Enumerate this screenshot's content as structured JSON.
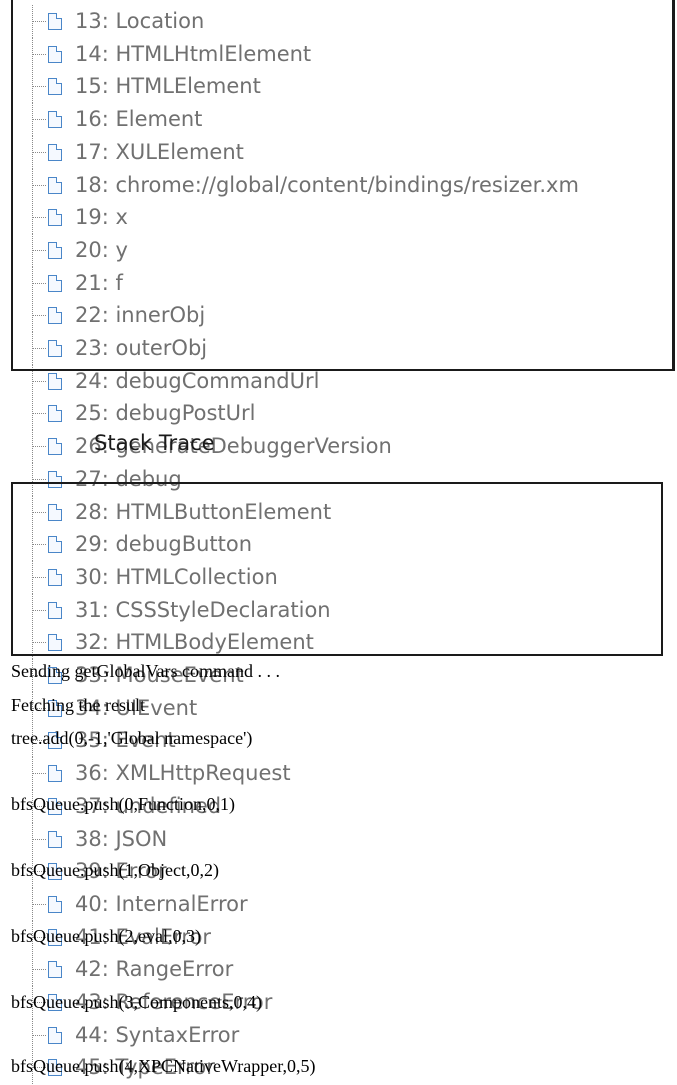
{
  "tree": {
    "nodes": [
      {
        "label": "13: Location"
      },
      {
        "label": "14: HTMLHtmlElement"
      },
      {
        "label": "15: HTMLElement"
      },
      {
        "label": "16: Element"
      },
      {
        "label": "17: XULElement"
      },
      {
        "label": "18: chrome://global/content/bindings/resizer.xm"
      },
      {
        "label": "19: x"
      },
      {
        "label": "20: y"
      },
      {
        "label": "21: f"
      },
      {
        "label": "22: innerObj"
      },
      {
        "label": "23: outerObj"
      },
      {
        "label": "24: debugCommandUrl"
      },
      {
        "label": "25: debugPostUrl"
      },
      {
        "label": "26: generateDebuggerVersion"
      },
      {
        "label": "27: debug"
      },
      {
        "label": "28: HTMLButtonElement"
      },
      {
        "label": "29: debugButton"
      },
      {
        "label": "30: HTMLCollection"
      },
      {
        "label": "31: CSSStyleDeclaration"
      },
      {
        "label": "32: HTMLBodyElement"
      },
      {
        "label": "33: MouseEvent"
      },
      {
        "label": "34: UIEvent"
      },
      {
        "label": "35: Event"
      },
      {
        "label": "36: XMLHttpRequest"
      },
      {
        "label": "37: undefined"
      },
      {
        "label": "38: JSON"
      },
      {
        "label": "39: Error"
      },
      {
        "label": "40: InternalError"
      },
      {
        "label": "41: EvalError"
      },
      {
        "label": "42: RangeError"
      },
      {
        "label": "43: ReferenceError"
      },
      {
        "label": "44: SyntaxError"
      },
      {
        "label": "45: TypeError"
      }
    ]
  },
  "stack_trace": {
    "title": "Stack Trace"
  },
  "log": {
    "lines": [
      "Sending getGlobalVars command . . .",
      "Fetching the result",
      "tree.add(0,-1,'Global namespace')",
      "bfsQueue.push(0,Function,0,1)",
      "bfsQueue.push(1,Object,0,2)",
      "bfsQueue.push(2,eval,0,3)",
      "bfsQueue.push(3,Components,0,4)",
      "bfsQueue.push(4,XPCNativeWrapper,0,5)"
    ]
  }
}
